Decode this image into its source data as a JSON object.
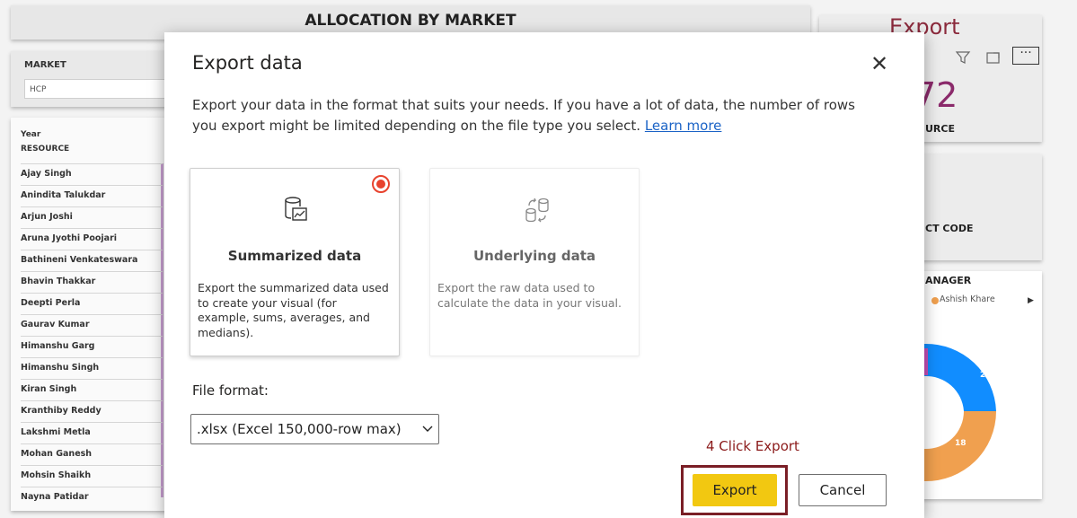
{
  "report": {
    "title": "ALLOCATION BY MARKET",
    "market_label": "MARKET",
    "market_value": "HCP",
    "table_headers": [
      "Year",
      "RESOURCE"
    ],
    "resources": [
      "Ajay Singh",
      "Anindita Talukdar",
      "Arjun Joshi",
      "Aruna Jyothi Poojari",
      "Bathineni Venkateswara",
      "Bhavin Thakkar",
      "Deepti Perla",
      "Gaurav Kumar",
      "Himanshu Garg",
      "Himanshu Singh",
      "Kiran Singh",
      "Kranthiby Reddy",
      "Lakshmi Metla",
      "Mohan Ganesh",
      "Mohsin Shaikh",
      "Nayna Patidar"
    ],
    "right": {
      "export_label": "Export",
      "card_value_partial": "72",
      "card1_label_partial": "URCE",
      "card2_label_partial": "CT CODE",
      "card3_title_partial": "ANAGER",
      "legend_item": "Ashish Khare",
      "donut_values": [
        "20",
        "18"
      ],
      "donut_colors": [
        "#118dff",
        "#f0a04f",
        "#c94fb8"
      ]
    }
  },
  "dialog": {
    "title": "Export data",
    "description": "Export your data in the format that suits your needs. If you have a lot of data, the number of rows you export might be limited depending on the file type you select.",
    "learn_more": "Learn more",
    "options": [
      {
        "title": "Summarized data",
        "description": "Export the summarized data used to create your visual (for example, sums, averages, and medians).",
        "selected": true
      },
      {
        "title": "Underlying data",
        "description": "Export the raw data used to calculate the data in your visual.",
        "selected": false
      }
    ],
    "file_format_label": "File format:",
    "file_format_value": ".xlsx (Excel 150,000-row max)",
    "export_button": "Export",
    "cancel_button": "Cancel"
  },
  "annotation": {
    "step_note": "4 Click Export",
    "highlight_color": "#7a1e26"
  }
}
